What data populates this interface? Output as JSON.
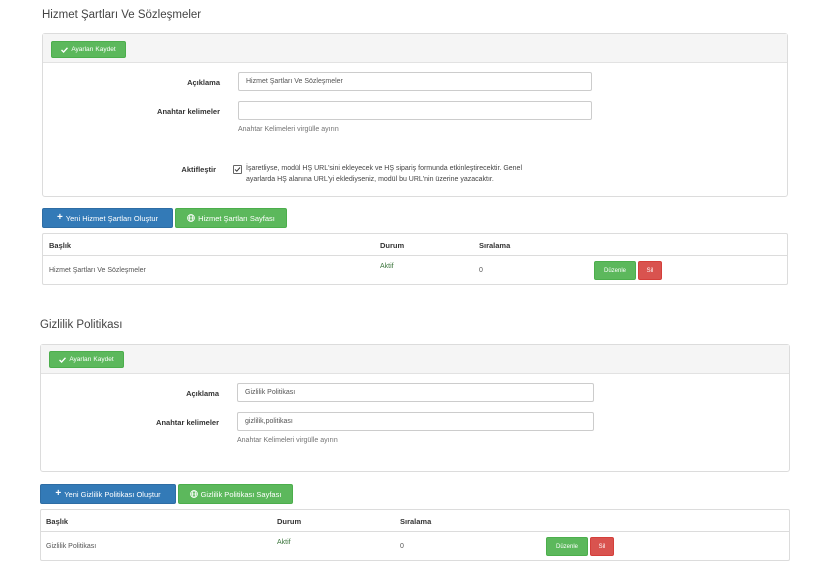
{
  "tos": {
    "title": "Hizmet Şartları Ve Sözleşmeler",
    "save_label": "Ayarları Kaydet",
    "description_label": "Açıklama",
    "description_value": "Hizmet Şartları Ve Sözleşmeler",
    "keywords_label": "Anahtar kelimeler",
    "keywords_value": "",
    "keywords_help": "Anahtar Kelimeleri virgülle ayırın",
    "activate_label": "Aktifleştir",
    "activate_text_line1": "İşaretliyse, modül HŞ URL'sini ekleyecek ve HŞ sipariş formunda etkinleştirecektir. Genel",
    "activate_text_line2": "ayarlarda HŞ alanına URL'yi eklediyseniz, modül bu URL'nin üzerine yazacaktır.",
    "new_button": "Yeni Hizmet Şartları Oluştur",
    "page_button": "Hizmet Şartları Sayfası",
    "table": {
      "headers": [
        "Başlık",
        "Durum",
        "Sıralama"
      ],
      "rows": [
        {
          "title": "Hizmet Şartları Ve Sözleşmeler",
          "status": "Aktif",
          "order": "0",
          "edit": "Düzenle",
          "delete": "Sil"
        }
      ]
    }
  },
  "privacy": {
    "title": "Gizlilik Politikası",
    "save_label": "Ayarları Kaydet",
    "description_label": "Açıklama",
    "description_value": "Gizlilik Politikası",
    "keywords_label": "Anahtar kelimeler",
    "keywords_value": "gizlilik,politikası",
    "keywords_help": "Anahtar Kelimeleri virgülle ayırın",
    "new_button": "Yeni Gizlilik Politikası Oluştur",
    "page_button": "Gizlilik Politikası Sayfası",
    "table": {
      "headers": [
        "Başlık",
        "Durum",
        "Sıralama"
      ],
      "rows": [
        {
          "title": "Gizlilik Politikası",
          "status": "Aktif",
          "order": "0",
          "edit": "Düzenle",
          "delete": "Sil"
        }
      ]
    }
  },
  "colors": {
    "green": "#5cb85c",
    "blue": "#337ab7",
    "red": "#d9534f",
    "status_green": "#3c763d"
  }
}
